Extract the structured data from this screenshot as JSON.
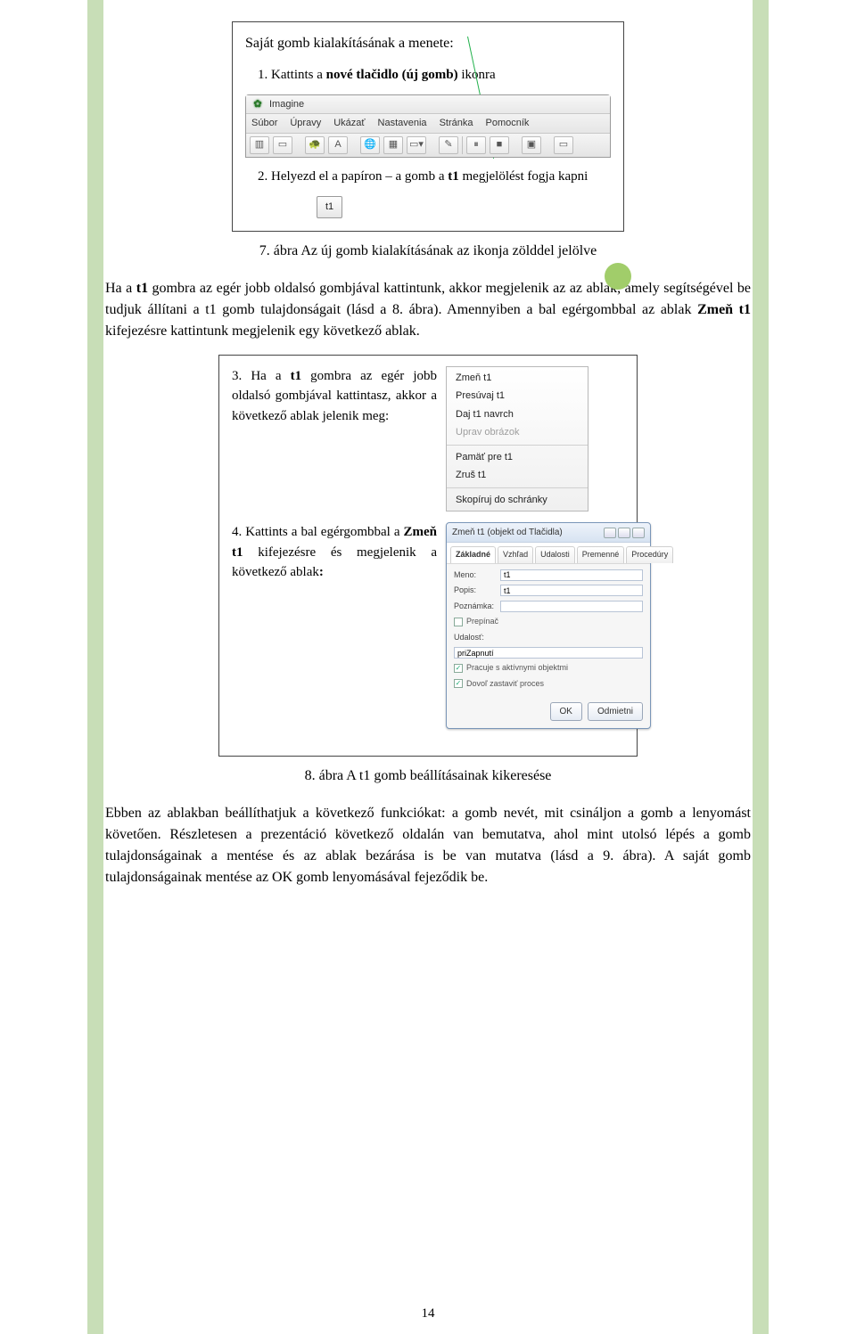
{
  "figure1": {
    "title": "Saját gomb kialakításának a menete:",
    "step1_pre": "1. Kattints a ",
    "step1_bold": "nové tlačidlo (új gomb)",
    "step1_post": " ikonra",
    "imagine": {
      "title": "Imagine",
      "menu": [
        "Súbor",
        "Úpravy",
        "Ukázať",
        "Nastavenia",
        "Stránka",
        "Pomocník"
      ]
    },
    "step2_pre": "2. Helyezd el a papíron – a gomb a ",
    "step2_bold": "t1",
    "step2_post": " megjelölést fogja kapni",
    "t1_label": "t1"
  },
  "caption1": "7. ábra Az új gomb kialakításának az ikonja zölddel jelölve",
  "para1": {
    "a": "Ha a ",
    "b": "t1",
    "c": " gombra az egér jobb oldalsó gombjával kattintunk, akkor megjelenik az az ablak, amely segítségével be tudjuk állítani a t1 gomb tulajdonságait (lásd a 8. ábra). Amennyiben a bal egérgombbal az ablak ",
    "d": "Zmeň t1",
    "e": " kifejezésre kattintunk megjelenik egy következő ablak."
  },
  "figure2": {
    "step3_pre": "3. Ha a ",
    "step3_bold": "t1",
    "step3_post": " gombra az egér jobb oldalsó gombjával kattintasz, akkor a következő ablak jelenik meg:",
    "menu_items": [
      {
        "label": "Zmeň t1",
        "disabled": false
      },
      {
        "label": "Presúvaj t1",
        "disabled": false
      },
      {
        "label": "Daj t1 navrch",
        "disabled": false
      },
      {
        "label": "Uprav obrázok",
        "disabled": true
      }
    ],
    "menu_items2": [
      {
        "label": "Pamäť pre t1",
        "disabled": false
      },
      {
        "label": "Zruš t1",
        "disabled": false
      }
    ],
    "menu_items3": [
      {
        "label": "Skopíruj do schránky",
        "disabled": false
      }
    ],
    "step4_pre": "4. Kattints a bal egérgombbal a ",
    "step4_bold": "Zmeň t1",
    "step4_post": " kifejezésre és megjelenik a következő ablak",
    "step4_colon": ":",
    "dialog": {
      "title": "Zmeň t1 (objekt od Tlačidla)",
      "tabs": [
        "Základné",
        "Vzhľad",
        "Udalosti",
        "Premenné",
        "Procedúry"
      ],
      "rows": {
        "meno_label": "Meno:",
        "meno_value": "t1",
        "popis_label": "Popis:",
        "popis_value": "t1",
        "pozn_label": "Poznámka:",
        "pozn_value": ""
      },
      "check_prepin": "Prepínač",
      "udalost_label": "Udalosť:",
      "udalost_value": "priZapnutí",
      "check_active": "Pracuje s aktívnymi objektmi",
      "check_allow": "Dovoľ zastaviť proces",
      "btn_ok": "OK",
      "btn_cancel": "Odmietni"
    }
  },
  "caption2": "8. ábra A t1 gomb beállításainak kikeresése",
  "para2": "Ebben az ablakban beállíthatjuk a következő funkciókat: a gomb nevét, mit csináljon a gomb a lenyomást követően. Részletesen a prezentáció következő oldalán van bemutatva, ahol mint utolsó lépés a gomb tulajdonságainak a mentése és az ablak bezárása is be van mutatva (lásd a 9. ábra). A saját gomb tulajdonságainak mentése az OK gomb lenyomásával fejeződik be.",
  "page_number": "14"
}
